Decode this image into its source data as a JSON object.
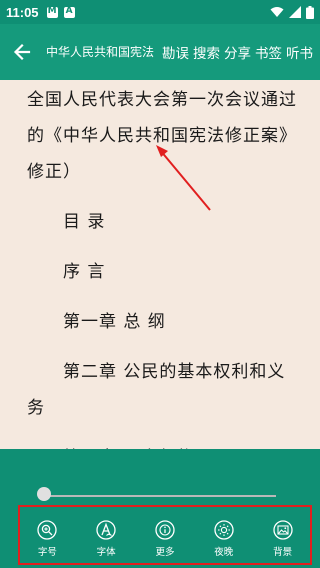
{
  "status_bar": {
    "time": "11:05",
    "icons": [
      "m-app-icon",
      "a-app-icon",
      "wifi-icon",
      "signal-icon",
      "battery-icon"
    ]
  },
  "app_bar": {
    "title": "中华人民共和国宪法",
    "actions": [
      "勘误",
      "搜索",
      "分享",
      "书签",
      "听书"
    ]
  },
  "content": {
    "paragraphs": [
      "全国人民代表大会第一次会议通过的《中华人民共和国宪法修正案》修正）",
      "目 录",
      "序 言",
      "第一章 总 纲",
      "第二章 公民的基本权利和义务",
      "第三章 国家机构"
    ]
  },
  "reader_menu": {
    "progress": 0.0,
    "items": [
      {
        "label": "字号",
        "icon": "font-size-icon"
      },
      {
        "label": "字体",
        "icon": "font-style-icon"
      },
      {
        "label": "更多",
        "icon": "more-info-icon"
      },
      {
        "label": "夜晚",
        "icon": "night-mode-icon"
      },
      {
        "label": "背景",
        "icon": "background-icon"
      }
    ]
  },
  "colors": {
    "header": "#159a7c",
    "status_bar": "#0f8f74",
    "page_background": "#f5e9df",
    "annotation": "#e11f1f"
  }
}
